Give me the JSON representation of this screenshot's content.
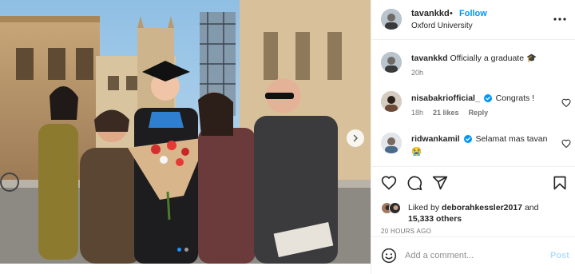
{
  "post": {
    "username": "tavankkd",
    "separator": "•",
    "follow_label": "Follow",
    "location": "Oxford University"
  },
  "media": {
    "carousel_count": 2,
    "carousel_active_index": 0
  },
  "comments": [
    {
      "username": "tavankkd",
      "text": "Officially a graduate",
      "emoji": "🎓",
      "time": "20h",
      "verified": false
    },
    {
      "username": "nisabakriofficial_",
      "text": "Congrats !",
      "time": "18h",
      "likes": "21 likes",
      "reply_label": "Reply",
      "verified": true
    },
    {
      "username": "ridwankamil",
      "text": "Selamat mas tavan",
      "emoji": "😭",
      "verified": true
    }
  ],
  "likes": {
    "prefix": "Liked by",
    "first_user": "deborahkessler2017",
    "conjunction": "and",
    "others": "15,333 others"
  },
  "timestamp": "20 HOURS AGO",
  "add_comment": {
    "placeholder": "Add a comment...",
    "post_label": "Post"
  },
  "colors": {
    "accent": "#0095f6",
    "post_disabled": "#b2dffc",
    "verified": "#0095f6",
    "secondary_text": "#737373"
  },
  "icons": {
    "more": "more-horizontal-icon",
    "like": "heart-icon",
    "comment": "comment-icon",
    "share": "send-icon",
    "save": "bookmark-icon",
    "emoji": "emoji-icon",
    "next": "chevron-right-icon"
  }
}
